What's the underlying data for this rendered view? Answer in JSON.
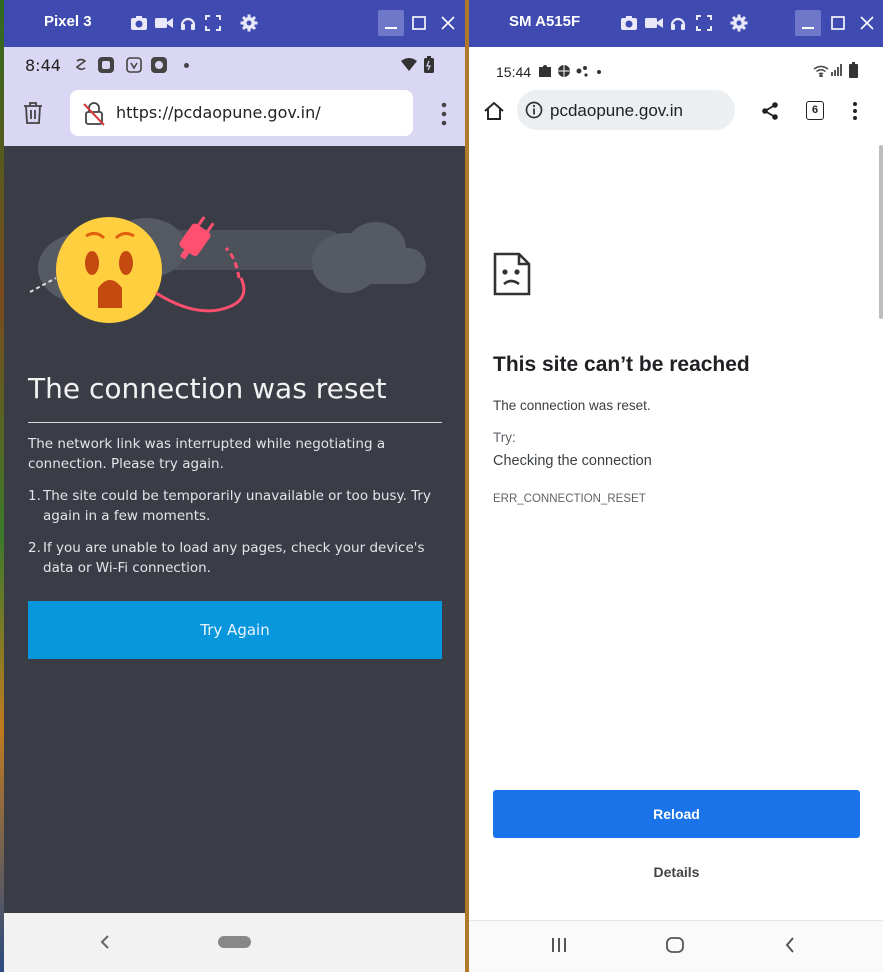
{
  "left_window": {
    "title": "Pixel 3",
    "toolbar_icons": [
      "camera-icon",
      "video-icon",
      "headphones-icon",
      "screenshot-frame-icon",
      "gear-icon"
    ],
    "status_bar": {
      "time": "8:44"
    },
    "url_bar": {
      "url": "https://pcdaopune.gov.in/"
    },
    "error_page": {
      "title": "The connection was reset",
      "description": "The network link was interrupted while negotiating a connection. Please try again.",
      "list": [
        {
          "num": "1.",
          "text": "The site could be temporarily unavailable or too busy. Try again in a few moments."
        },
        {
          "num": "2.",
          "text": "If you are unable to load any pages, check your device's data or Wi-Fi connection."
        }
      ],
      "button_label": "Try Again"
    },
    "colors": {
      "titlebar": "#3f4bb0",
      "content_bg": "#3a3d46",
      "button": "#0897dc",
      "status_bg": "#d9d7f3"
    }
  },
  "right_window": {
    "title": "SM A515F",
    "status_bar": {
      "time": "15:44"
    },
    "url_bar": {
      "url": "pcdaopune.gov.in",
      "tab_count": "6"
    },
    "error_page": {
      "title": "This site can’t be reached",
      "message": "The connection was reset.",
      "try_label": "Try:",
      "suggestion": "Checking the connection",
      "error_code": "ERR_CONNECTION_RESET",
      "reload_label": "Reload",
      "details_label": "Details"
    },
    "colors": {
      "reload_button": "#1a73e8"
    }
  }
}
